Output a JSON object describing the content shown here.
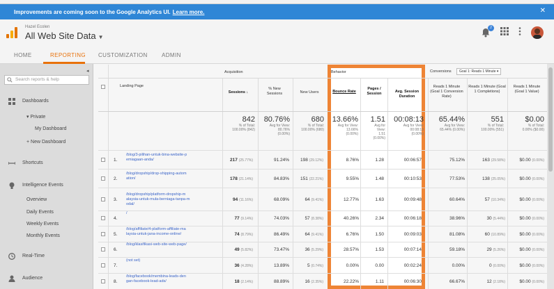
{
  "banner": {
    "text": "Improvements are coming soon to the Google Analytics UI.",
    "link": "Learn more."
  },
  "account": {
    "small": "Hazel Ecolen",
    "name": "All Web Site Data"
  },
  "notif_count": "2",
  "tabs": [
    {
      "label": "HOME"
    },
    {
      "label": "REPORTING"
    },
    {
      "label": "CUSTOMIZATION"
    },
    {
      "label": "ADMIN"
    }
  ],
  "sidebar": {
    "search_placeholder": "Search reports & help",
    "dashboards": "Dashboards",
    "private": "▾ Private",
    "my_dashboard": "My Dashboard",
    "new_dashboard": "+ New Dashboard",
    "shortcuts": "Shortcuts",
    "intelligence": "Intelligence Events",
    "overview": "Overview",
    "daily": "Daily Events",
    "weekly": "Weekly Events",
    "monthly": "Monthly Events",
    "realtime": "Real-Time",
    "audience": "Audience"
  },
  "table": {
    "groups": {
      "acq": "Acquisition",
      "beh": "Behavior",
      "conv": "Conversions",
      "goal": "Goal 1: Reads 1 Minute"
    },
    "headers": {
      "landing": "Landing Page",
      "sessions": "Sessions",
      "new_sessions": "% New Sessions",
      "new_users": "New Users",
      "bounce": "Bounce Rate",
      "pages": "Pages / Session",
      "duration": "Avg. Session Duration",
      "g1": "Reads 1 Minute (Goal 1 Conversion Rate)",
      "g2": "Reads 1 Minute (Goal 1 Completions)",
      "g3": "Reads 1 Minute (Goal 1 Value)"
    },
    "totals": {
      "sessions": {
        "big": "842",
        "s1": "% of Total:",
        "s2": "100.00% (842)"
      },
      "new_sessions": {
        "big": "80.76%",
        "s1": "Avg for View:",
        "s2": "80.76%",
        "s3": "(0.00%)"
      },
      "new_users": {
        "big": "680",
        "s1": "% of Total:",
        "s2": "100.00% (680)"
      },
      "bounce": {
        "big": "13.66%",
        "s1": "Avg for View:",
        "s2": "13.66%",
        "s3": "(0.00%)"
      },
      "pages": {
        "big": "1.51",
        "s1": "Avg for",
        "s2": "View:",
        "s3": "1.51",
        "s4": "(0.00%)"
      },
      "duration": {
        "big": "00:08:13",
        "s1": "Avg for View:",
        "s2": "00:08:13",
        "s3": "(0.00%)"
      },
      "g1": {
        "big": "65.44%",
        "s1": "Avg for View:",
        "s2": "65.44% (0.00%)"
      },
      "g2": {
        "big": "551",
        "s1": "% of Total:",
        "s2": "100.00% (551)"
      },
      "g3": {
        "big": "$0.00",
        "s1": "% of Total:",
        "s2": "0.00% ($0.00)"
      }
    },
    "rows": [
      {
        "n": "1.",
        "page": "/blog/3-pilihan-untuk-bina-website-p emiagaan-anda/",
        "s": "217",
        "sp": "(25.77%)",
        "ns": "91.24%",
        "nu": "198",
        "nup": "(29.12%)",
        "br": "8.76%",
        "ps": "1.28",
        "dur": "00:06:57",
        "g1": "75.12%",
        "g2": "163",
        "g2p": "(29.58%)",
        "g3": "$0.00",
        "g3p": "(0.00%)"
      },
      {
        "n": "2.",
        "page": "/blog/dropship/drop-shipping-autom ation/",
        "s": "178",
        "sp": "(21.14%)",
        "ns": "84.83%",
        "nu": "151",
        "nup": "(22.21%)",
        "br": "9.55%",
        "ps": "1.48",
        "dur": "00:10:53",
        "g1": "77.53%",
        "g2": "138",
        "g2p": "(25.05%)",
        "g3": "$0.00",
        "g3p": "(0.00%)"
      },
      {
        "n": "3.",
        "page": "/blog/dropship/platform-dropship-m alaysia-untuk-mula-berniaga-tanpa-m odal/",
        "s": "94",
        "sp": "(11.16%)",
        "ns": "68.09%",
        "nu": "64",
        "nup": "(9.41%)",
        "br": "12.77%",
        "ps": "1.63",
        "dur": "00:09:48",
        "g1": "60.64%",
        "g2": "57",
        "g2p": "(10.34%)",
        "g3": "$0.00",
        "g3p": "(0.00%)"
      },
      {
        "n": "4.",
        "page": "/",
        "s": "77",
        "sp": "(9.14%)",
        "ns": "74.03%",
        "nu": "57",
        "nup": "(8.38%)",
        "br": "40.26%",
        "ps": "2.34",
        "dur": "00:06:18",
        "g1": "38.96%",
        "g2": "30",
        "g2p": "(5.44%)",
        "g3": "$0.00",
        "g3p": "(0.00%)"
      },
      {
        "n": "5.",
        "page": "/blog/affiliate/4-platform-affiliate-ma laysia-untuk-jana-income-online/",
        "s": "74",
        "sp": "(8.79%)",
        "ns": "86.49%",
        "nu": "64",
        "nup": "(9.41%)",
        "br": "6.76%",
        "ps": "1.50",
        "dur": "00:09:03",
        "g1": "81.08%",
        "g2": "60",
        "g2p": "(10.89%)",
        "g3": "$0.00",
        "g3p": "(0.00%)"
      },
      {
        "n": "6.",
        "page": "/blog/klasifikasi-web-site-web-page/",
        "s": "49",
        "sp": "(5.82%)",
        "ns": "73.47%",
        "nu": "36",
        "nup": "(5.29%)",
        "br": "28.57%",
        "ps": "1.53",
        "dur": "00:07:14",
        "g1": "59.18%",
        "g2": "29",
        "g2p": "(5.26%)",
        "g3": "$0.00",
        "g3p": "(0.00%)"
      },
      {
        "n": "7.",
        "page": "(not set)",
        "s": "36",
        "sp": "(4.28%)",
        "ns": "13.89%",
        "nu": "5",
        "nup": "(0.74%)",
        "br": "0.00%",
        "ps": "0.00",
        "dur": "00:02:24",
        "g1": "0.00%",
        "g2": "0",
        "g2p": "(0.00%)",
        "g3": "$0.00",
        "g3p": "(0.00%)"
      },
      {
        "n": "8.",
        "page": "/blog/facebook/membina-leads-den gan-facebook-lead-ads/",
        "s": "18",
        "sp": "(2.14%)",
        "ns": "88.89%",
        "nu": "16",
        "nup": "(2.35%)",
        "br": "22.22%",
        "ps": "1.11",
        "dur": "00:06:30",
        "g1": "66.67%",
        "g2": "12",
        "g2p": "(2.18%)",
        "g3": "$0.00",
        "g3p": "(0.00%)"
      }
    ]
  },
  "colors": {
    "accent": "#e8710a",
    "highlight": "#ee8435",
    "banner": "#2f86d6",
    "link": "#3a64c8"
  }
}
